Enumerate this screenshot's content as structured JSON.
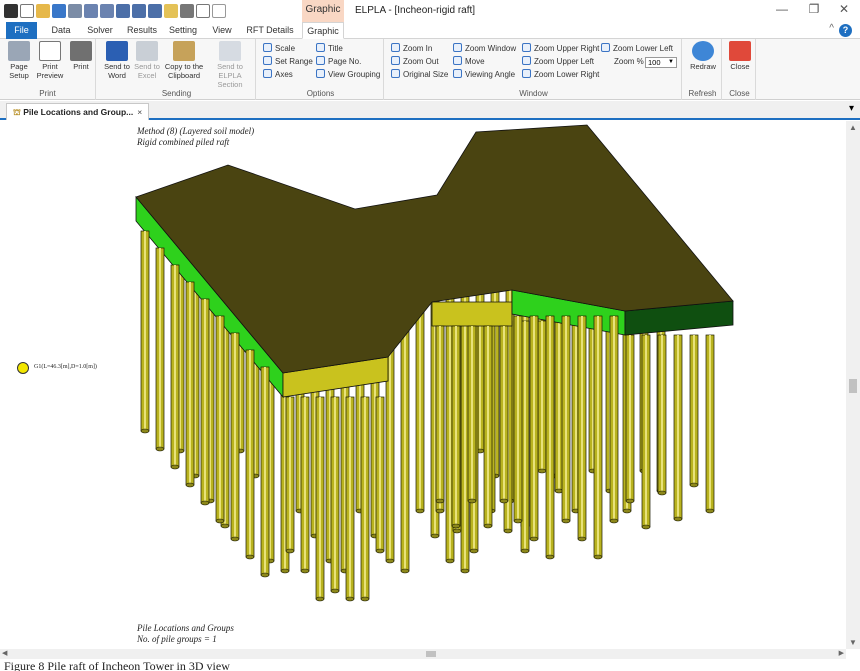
{
  "window": {
    "title": "ELPLA - [Incheon-rigid raft]",
    "context_tab_group": "Graphic",
    "minimize": "—",
    "restore": "❐",
    "close": "✕"
  },
  "ribbon_tabs": [
    "File",
    "Data",
    "Solver",
    "Results",
    "Setting",
    "View",
    "RFT Details",
    "Graphic"
  ],
  "active_tab": "Graphic",
  "ribbon": {
    "print_group": {
      "label": "Print",
      "buttons": [
        {
          "label": "Page\nSetup",
          "icon": "page-setup-icon"
        },
        {
          "label": "Print\nPreview",
          "icon": "print-preview-icon"
        },
        {
          "label": "Print",
          "icon": "printer-icon"
        }
      ]
    },
    "sending_group": {
      "label": "Sending",
      "buttons": [
        {
          "label": "Send to\nWord",
          "icon": "word-icon",
          "enabled": true
        },
        {
          "label": "Send to\nExcel",
          "icon": "excel-icon",
          "enabled": false
        },
        {
          "label": "Copy to the\nClipboard",
          "icon": "clipboard-icon",
          "enabled": true
        },
        {
          "label": "Send to ELPLA\nSection",
          "icon": "section-icon",
          "enabled": false
        }
      ]
    },
    "options_group": {
      "label": "Options",
      "buttons": [
        "Scale",
        "Set Range",
        "Axes",
        "Title",
        "Page No.",
        "View Grouping"
      ]
    },
    "window_group": {
      "label": "Window",
      "buttons": [
        "Zoom In",
        "Zoom Out",
        "Original Size",
        "Zoom Window",
        "Move",
        "Viewing Angle",
        "Zoom Upper Right",
        "Zoom Upper Left",
        "Zoom Lower Right",
        "Zoom Lower Left"
      ],
      "zoom_label": "Zoom %",
      "zoom_value": "100"
    },
    "refresh_group": {
      "label": "Refresh",
      "button": "Redraw"
    },
    "close_group": {
      "label": "Close",
      "button": "Close"
    }
  },
  "document_tab": {
    "label": "Pile Locations and Group...",
    "close": "×"
  },
  "drawing": {
    "method_line1": "Method (8) (Layered soil model)",
    "method_line2": "Rigid combined piled raft",
    "legend_label": "G1(L=46.3[m],D=1.0[m])",
    "footer_line1": "Pile Locations and Groups",
    "footer_line2": "No. of pile groups = 1",
    "colors": {
      "raft_top": "#4a4411",
      "raft_green": "#2ed11c",
      "raft_dark_green": "#0f4f10",
      "raft_yellow_face": "#c9c21e",
      "pile": "#b9b31f"
    }
  },
  "caption": "Figure 8 Pile raft of Incheon Tower in 3D view"
}
